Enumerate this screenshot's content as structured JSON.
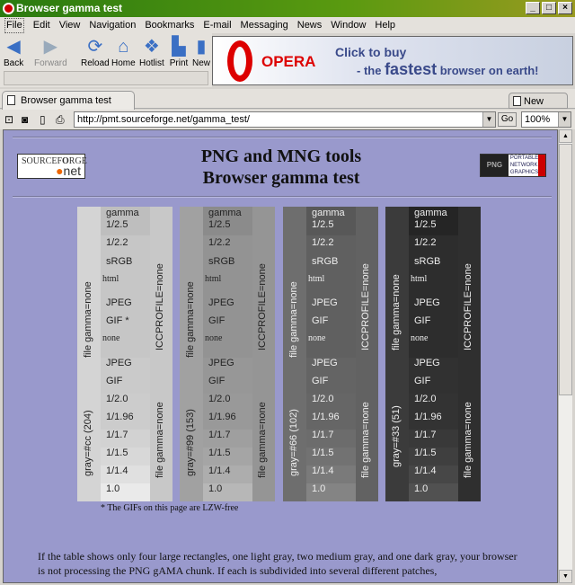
{
  "window": {
    "title": "Browser gamma test",
    "controls": [
      "_",
      "□",
      "×"
    ]
  },
  "menu": [
    "File",
    "Edit",
    "View",
    "Navigation",
    "Bookmarks",
    "E-mail",
    "Messaging",
    "News",
    "Window",
    "Help"
  ],
  "toolbar": {
    "back": "Back",
    "forward": "Forward",
    "reload": "Reload",
    "home": "Home",
    "hotlist": "Hotlist",
    "print": "Print",
    "new": "New"
  },
  "banner": {
    "brand": "OPERA",
    "line1": "Click to buy",
    "line2_pre": "- the ",
    "line2_bold": "fastest",
    "line2_post": " browser on earth!"
  },
  "tabs": {
    "active": "Browser gamma test",
    "new_page": "New page"
  },
  "address": {
    "url": "http://pmt.sourceforge.net/gamma_test/",
    "go": "Go",
    "zoom": "100%"
  },
  "page": {
    "title1": "PNG and MNG tools",
    "title2": "Browser gamma test",
    "sf_logo": "SOURCEFORGE .net",
    "png_logo": "PNG Portable Network Graphics now!",
    "note": "* The GIFs on this page are LZW-free",
    "paragraph": "If the table shows only four large rectangles, one light gray, two medium gray, and one dark gray, your browser is not processing the PNG gAMA chunk. If each is subdivided into several different patches,",
    "panels": [
      {
        "gray": "gray=#cc (204)",
        "base": "#cccccc",
        "text": "#222222",
        "gif_label": "GIF *"
      },
      {
        "gray": "gray=#99 (153)",
        "base": "#999999",
        "text": "#222222",
        "gif_label": "GIF"
      },
      {
        "gray": "gray=#66 (102)",
        "base": "#666666",
        "text": "#eeeeee",
        "gif_label": "GIF"
      },
      {
        "gray": "gray=#33 (51)",
        "base": "#333333",
        "text": "#eeeeee",
        "gif_label": "GIF"
      }
    ],
    "left_label_top": "file gamma=none",
    "right_label_top": "ICCPROFILE=none",
    "right_label_bottom": "file gamma=none",
    "rows": [
      "gamma",
      "1/2.5",
      "1/2.2",
      "sRGB",
      "html",
      "JPEG",
      "GIF",
      "none",
      "JPEG",
      "GIF",
      "1/2.0",
      "1/1.96",
      "1/1.7",
      "1/1.5",
      "1/1.4",
      "1.0"
    ]
  }
}
